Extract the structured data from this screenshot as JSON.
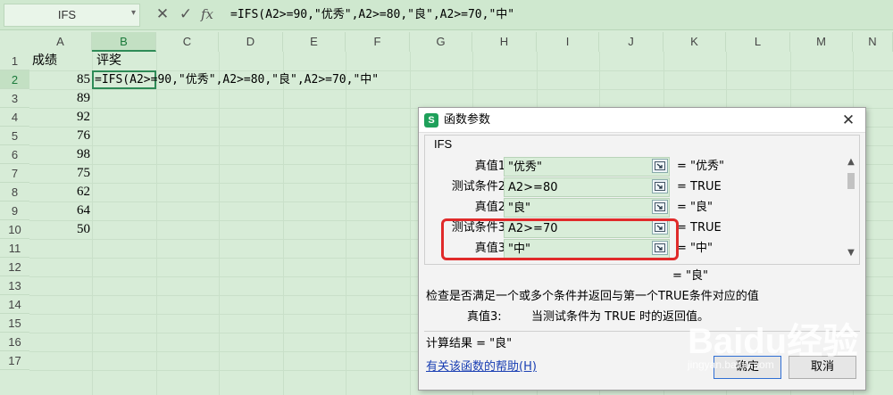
{
  "formula_bar": {
    "name_box": "IFS",
    "cancel_icon": "close-icon",
    "confirm_icon": "check-icon",
    "fx_label": "fx",
    "formula": "=IFS(A2>=90,\"优秀\",A2>=80,\"良\",A2>=70,\"中\""
  },
  "sheet": {
    "columns": [
      "A",
      "B",
      "C",
      "D",
      "E",
      "F",
      "G",
      "H",
      "I",
      "J",
      "K",
      "L",
      "M",
      "N"
    ],
    "active_column": "B",
    "rows": [
      "1",
      "2",
      "3",
      "4",
      "5",
      "6",
      "7",
      "8",
      "9",
      "10",
      "11",
      "12",
      "13",
      "14",
      "15",
      "16",
      "17"
    ],
    "active_row": "2",
    "headers": {
      "a1": "成绩",
      "b1": "评奖"
    },
    "scores": [
      "85",
      "89",
      "92",
      "76",
      "98",
      "75",
      "62",
      "64",
      "50"
    ],
    "editing_cell_text": "=IFS(A2>=90,\"优秀\",A2>=80,\"良\",A2>=70,\"中\""
  },
  "dialog": {
    "title": "函数参数",
    "close_icon": "close-icon",
    "function_name": "IFS",
    "args": [
      {
        "label": "真值1",
        "value": "\"优秀\"",
        "result": "= \"优秀\""
      },
      {
        "label": "测试条件2",
        "value": "A2>=80",
        "result": "= TRUE"
      },
      {
        "label": "真值2",
        "value": "\"良\"",
        "result": "= \"良\""
      },
      {
        "label": "测试条件3",
        "value": "A2>=70",
        "result": "= TRUE"
      },
      {
        "label": "真值3",
        "value": "\"中\"",
        "result": "= \"中\""
      }
    ],
    "overall_result": "= \"良\"",
    "description": "检查是否满足一个或多个条件并返回与第一个TRUE条件对应的值",
    "arg_desc_label": "真值3:",
    "arg_desc": "当测试条件为 TRUE 时的返回值。",
    "calc_result": "计算结果 = \"良\"",
    "help_link": "有关该函数的帮助(H)",
    "ok_label": "确定",
    "cancel_label": "取消"
  },
  "watermark": {
    "main": "Baidu经验",
    "sub": "jingyan.baidu.com"
  },
  "colors": {
    "sheet_bg": "#d7ecd7",
    "accent": "#2e8b57",
    "highlight": "#e02a2a",
    "input_bg": "#d9edd9"
  }
}
